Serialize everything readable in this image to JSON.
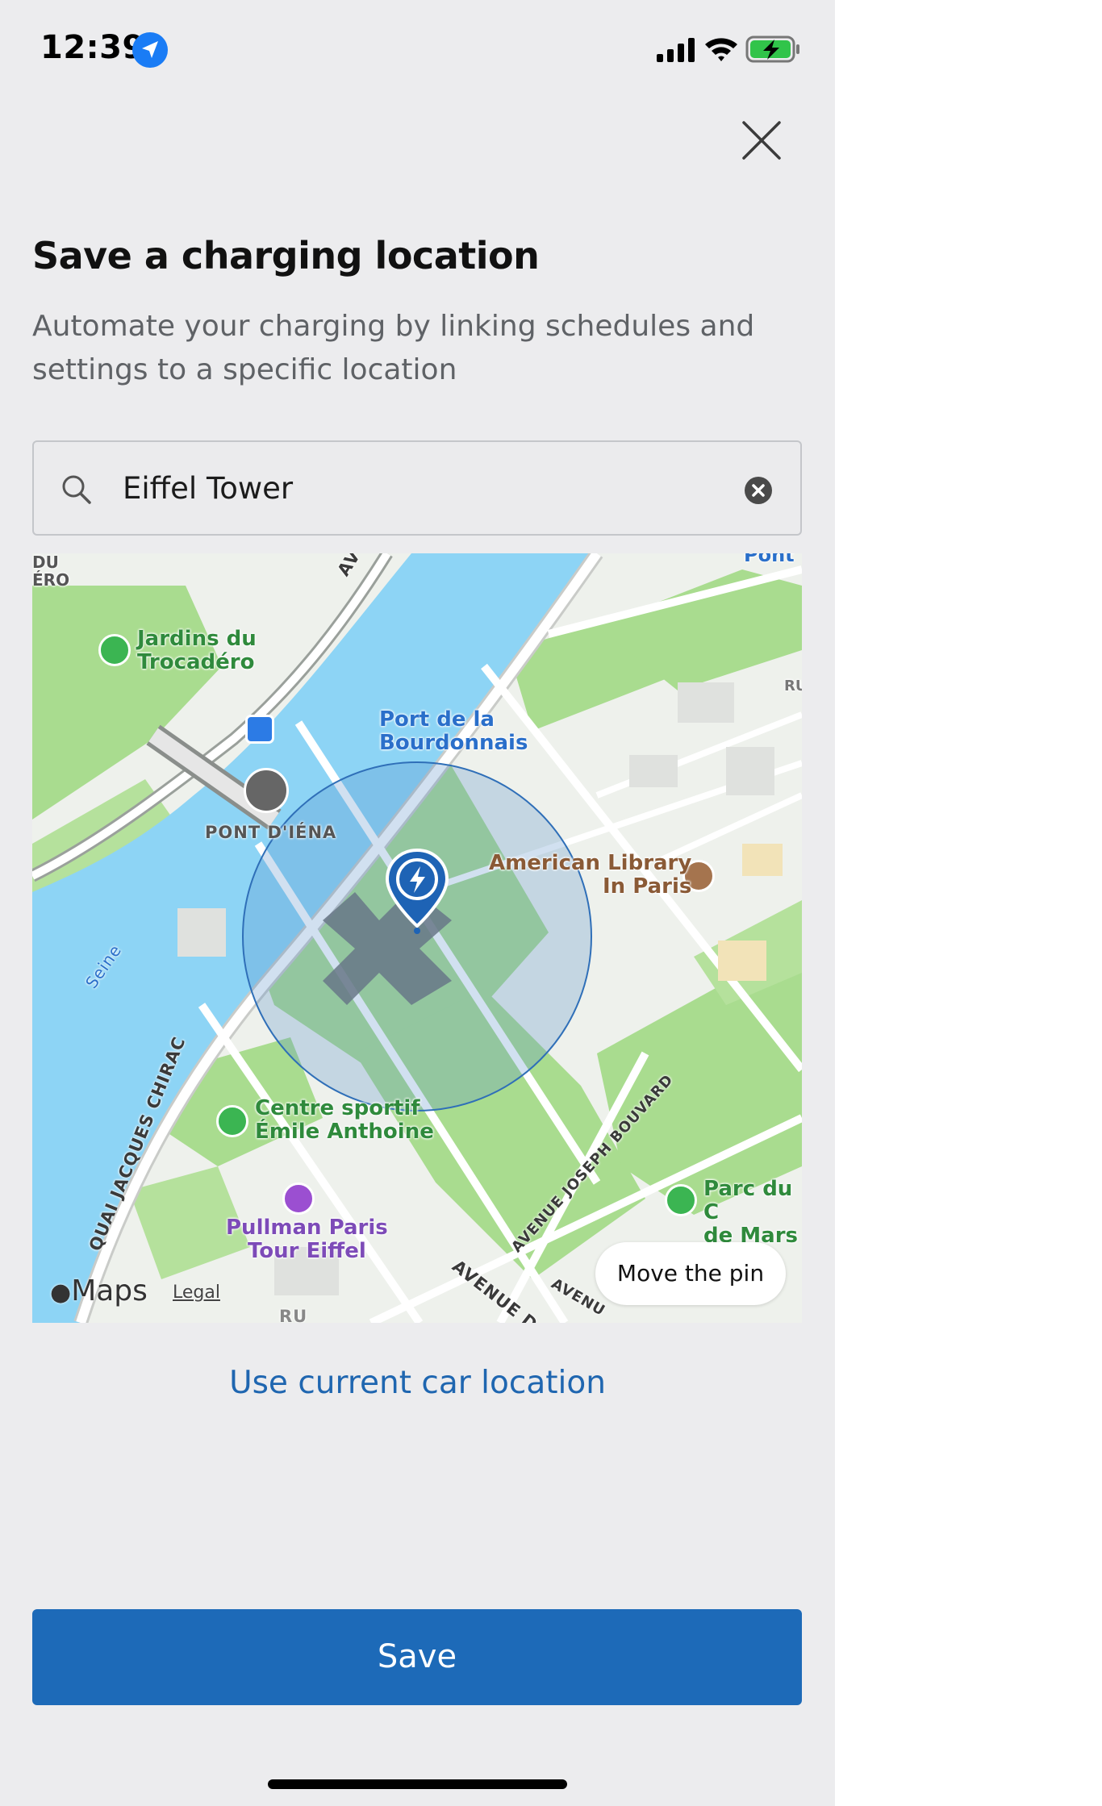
{
  "status_bar": {
    "time": "12:39",
    "icons": [
      "location-arrow-icon",
      "cellular-signal-icon",
      "wifi-icon",
      "battery-charging-icon"
    ]
  },
  "header": {
    "close_icon": "close-icon",
    "title": "Save a charging location",
    "subtitle": "Automate your charging by linking schedules and settings to a specific location"
  },
  "search": {
    "value": "Eiffel Tower",
    "icon": "search-icon",
    "clear_icon": "clear-icon"
  },
  "map": {
    "labels": {
      "top_left_fragment_1": "DU",
      "top_left_fragment_2": "ÉRO",
      "top_right_fragment": "Pont",
      "right_fragment_1": "RU",
      "jardins_1": "Jardins du",
      "jardins_2": "Trocadéro",
      "port_1": "Port de la",
      "port_2": "Bourdonnais",
      "pont_iena": "PONT D'IÉNA",
      "library_1": "American Library",
      "library_2": "In Paris",
      "seine": "Seine",
      "quai": "QUAI JACQUES CHIRAC",
      "centre_1": "Centre sportif",
      "centre_2": "Émile Anthoine",
      "pullman_1": "Pullman Paris",
      "pullman_2": "Tour Eiffel",
      "parc_1": "Parc du C",
      "parc_2": "de Mars",
      "av_bouvard": "AVENUE JOSEPH BOUVARD",
      "av_bottom_1": "AVENUE D",
      "av_bottom_2": "AVENU",
      "av_top": "AV",
      "ru_bottom": "RU",
      "maps_brand": "Maps",
      "legal": "Legal"
    },
    "move_pin_label": "Move the pin",
    "colors": {
      "water": "#8dd4f5",
      "park": "#a9dc8f",
      "land": "#eef1ec",
      "radius_fill": "#5a8fc8",
      "pin": "#1e63b5"
    },
    "icons": [
      "charging-pin-icon",
      "landmark-star-icon",
      "ferry-icon",
      "library-icon",
      "park-icon",
      "sports-icon",
      "hotel-icon",
      "tree-icon",
      "apple-logo-icon"
    ]
  },
  "actions": {
    "use_current_location": "Use current car location",
    "save": "Save"
  }
}
